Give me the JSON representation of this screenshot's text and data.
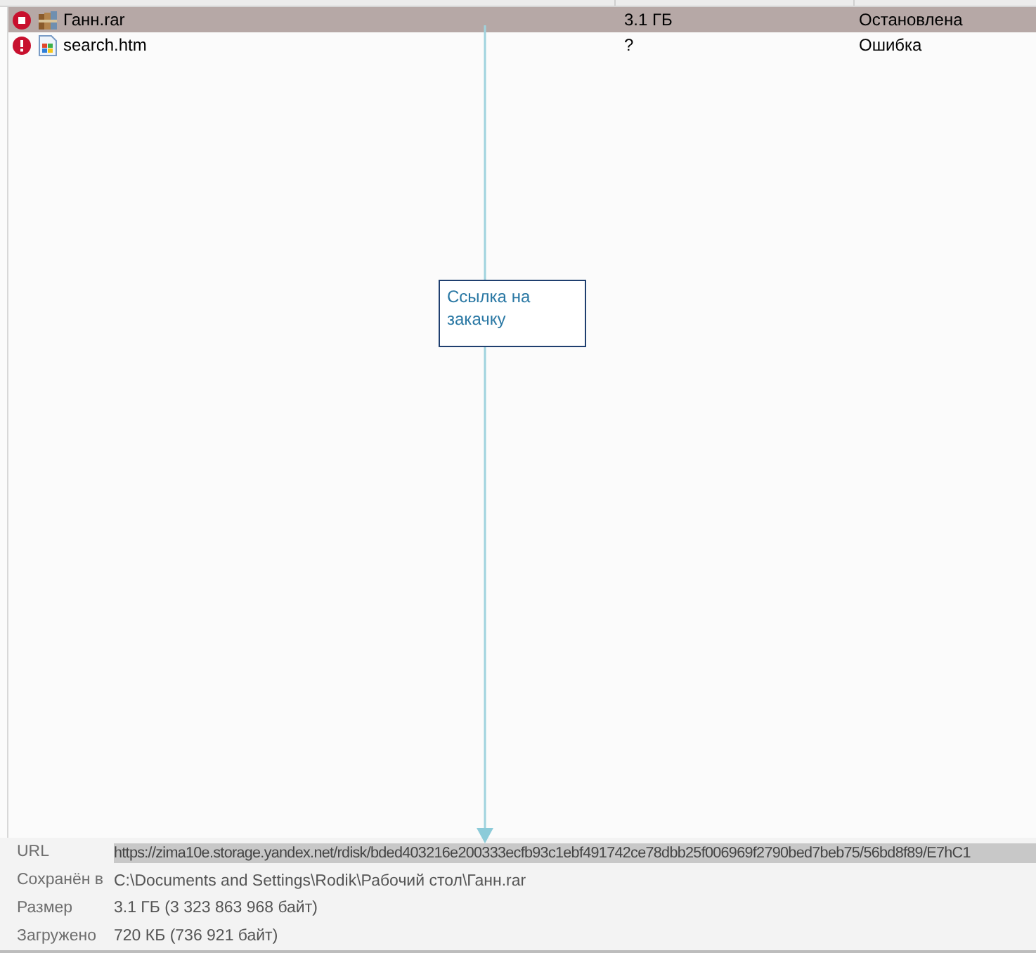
{
  "downloads": {
    "rows": [
      {
        "status_icon": {
          "kind": "stopped"
        },
        "file_icon": {
          "kind": "archive"
        },
        "name": "Ганн.rar",
        "size": "3.1 ГБ",
        "state": "Остановлена",
        "selected": true
      },
      {
        "status_icon": {
          "kind": "error"
        },
        "file_icon": {
          "kind": "web-page"
        },
        "name": "search.htm",
        "size": "?",
        "state": "Ошибка",
        "selected": false
      }
    ]
  },
  "annotation": {
    "text": "Ссылка на закачку"
  },
  "details": {
    "fields": [
      {
        "label": "URL",
        "value": "https://zima10e.storage.yandex.net/rdisk/bded403216e200333ecfb93c1ebf491742ce78dbb25f006969f2790bed7beb75/56bd8f89/E7hC1",
        "highlighted": true
      },
      {
        "label": "Сохранён в",
        "value": "C:\\Documents and Settings\\Rodik\\Рабочий стол\\Ганн.rar",
        "highlighted": false
      },
      {
        "label": "Размер",
        "value": "3.1 ГБ (3 323 863 968 байт)",
        "highlighted": false
      },
      {
        "label": "Загружено",
        "value": "720 КБ (736 921 байт)",
        "highlighted": false
      }
    ]
  }
}
